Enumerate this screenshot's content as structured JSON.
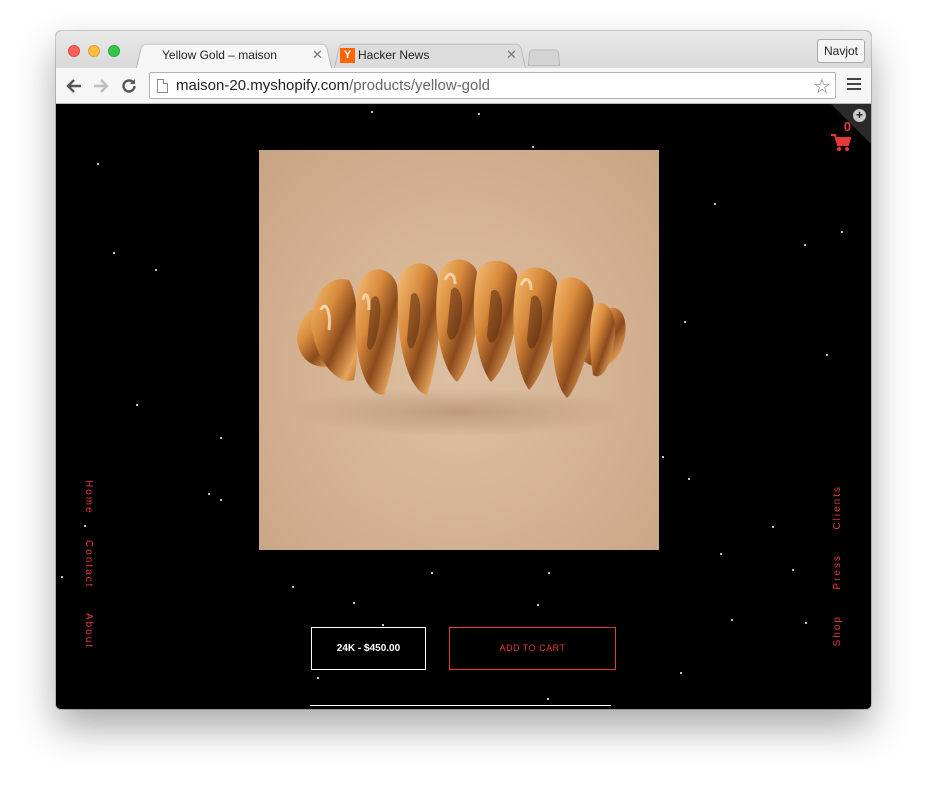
{
  "browser": {
    "tabs": [
      {
        "title": "Yellow Gold – maison",
        "active": true
      },
      {
        "title": "Hacker News",
        "active": false,
        "favicon": "Y"
      }
    ],
    "profile_name": "Navjot",
    "url_host": "maison-20.myshopify.com",
    "url_path": "/products/yellow-gold",
    "close_glyph": "✕",
    "back_icon": "back-arrow-icon",
    "forward_icon": "forward-arrow-icon",
    "reload_icon": "reload-icon",
    "bookmark_icon": "star-outline-icon",
    "menu_icon": "hamburger-icon"
  },
  "page": {
    "background_color": "#000000",
    "accent_color": "#e53935",
    "left_nav": [
      "Home",
      "Contact",
      "About"
    ],
    "right_nav": [
      "Clients",
      "Press",
      "Shop"
    ],
    "cart": {
      "count": "0",
      "plus_glyph": "+"
    },
    "product": {
      "variant_label": "24K - $450.00",
      "add_to_cart_label": "ADD TO CART",
      "image_subject": "gold-grill-image"
    }
  }
}
